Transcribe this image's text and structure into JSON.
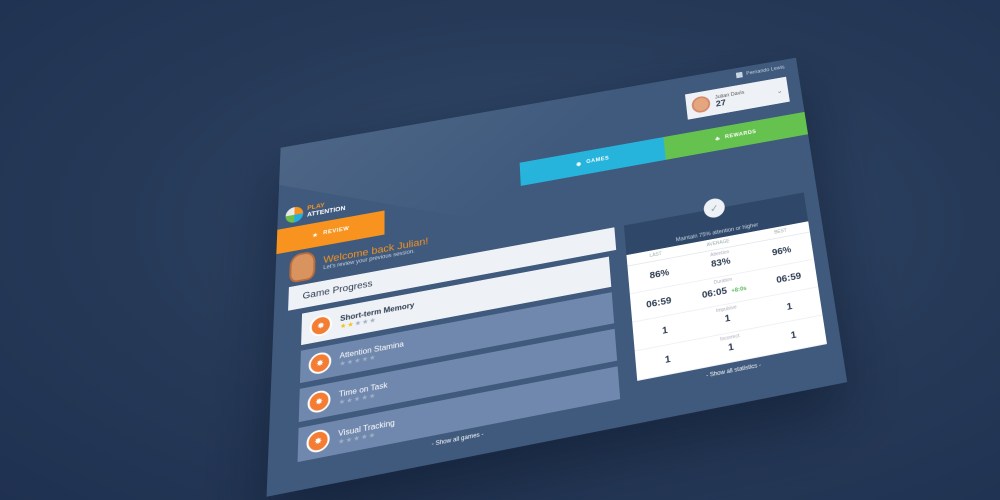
{
  "user_menu": {
    "name": "Fernando Lewis"
  },
  "profile": {
    "name": "Julian Davis",
    "number": "27"
  },
  "brand": {
    "line1": "PLAY",
    "line2": "ATTENTION"
  },
  "tabs": {
    "review": "REVIEW",
    "games": "GAMES",
    "rewards": "REWARDS"
  },
  "welcome": {
    "title": "Welcome back Julian!",
    "subtitle": "Let's review your previous session."
  },
  "progress": {
    "title": "Game Progress",
    "games": [
      {
        "name": "Short-term Memory",
        "stars": 2
      },
      {
        "name": "Attention Stamina",
        "stars": 0
      },
      {
        "name": "Time on Task",
        "stars": 0
      },
      {
        "name": "Visual Tracking",
        "stars": 0
      }
    ],
    "show_all": "- Show all games -"
  },
  "stats": {
    "goal": "Maintain 75% attention or higher",
    "columns": [
      "LAST",
      "AVERAGE",
      "BEST"
    ],
    "rows": [
      {
        "label": "Attention",
        "last": "86%",
        "average": "83%",
        "best": "96%"
      },
      {
        "label": "Duration",
        "last": "06:59",
        "average": "06:05",
        "diff": "+8:0s",
        "best": "06:59"
      },
      {
        "label": "Impulsive",
        "last": "1",
        "average": "1",
        "best": "1"
      },
      {
        "label": "Incorrect",
        "last": "1",
        "average": "1",
        "best": "1"
      }
    ],
    "show_all": "- Show all statistics -"
  },
  "colors": {
    "review": "#f7931e",
    "games": "#26b4dd",
    "rewards": "#66c24f",
    "panel": "#3f5a7d"
  }
}
